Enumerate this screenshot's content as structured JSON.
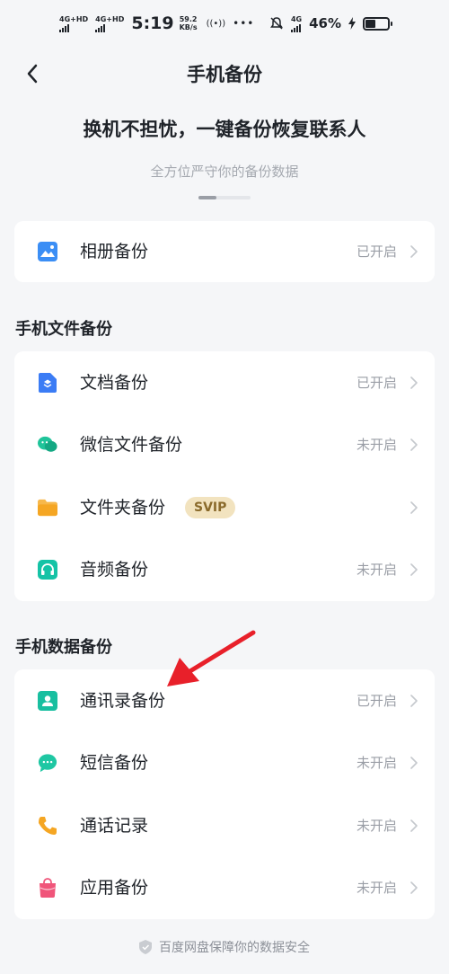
{
  "status_bar": {
    "network1": "4G+HD",
    "network2": "4G+HD",
    "time": "5:19",
    "speed_value": "59.2",
    "speed_unit": "KB/s",
    "hotspot": "((•))",
    "more": "•••",
    "network3": "4G",
    "battery_percent": "46%",
    "battery_level": 0.46
  },
  "nav": {
    "title": "手机备份"
  },
  "hero": {
    "title": "换机不担忧，一键备份恢复联系人",
    "subtitle": "全方位严守你的备份数据"
  },
  "album_card": {
    "label": "相册备份",
    "status": "已开启",
    "icon": "album-icon"
  },
  "files_section": {
    "title": "手机文件备份",
    "items": [
      {
        "label": "文档备份",
        "status": "已开启",
        "icon": "document-icon"
      },
      {
        "label": "微信文件备份",
        "status": "未开启",
        "icon": "wechat-icon"
      },
      {
        "label": "文件夹备份",
        "status": "",
        "badge": "SVIP",
        "icon": "folder-icon"
      },
      {
        "label": "音频备份",
        "status": "未开启",
        "icon": "headphones-icon"
      }
    ]
  },
  "data_section": {
    "title": "手机数据备份",
    "items": [
      {
        "label": "通讯录备份",
        "status": "已开启",
        "icon": "contacts-icon"
      },
      {
        "label": "短信备份",
        "status": "未开启",
        "icon": "message-icon"
      },
      {
        "label": "通话记录",
        "status": "未开启",
        "icon": "phone-icon"
      },
      {
        "label": "应用备份",
        "status": "未开启",
        "icon": "app-bag-icon"
      }
    ]
  },
  "footer": {
    "text": "百度网盘保障你的数据安全"
  },
  "colors": {
    "background": "#f5f6f8",
    "card": "#ffffff",
    "status_text": "#9a9ea6",
    "svip_bg": "#f2e3bf",
    "annotation_arrow": "#e8202a"
  }
}
